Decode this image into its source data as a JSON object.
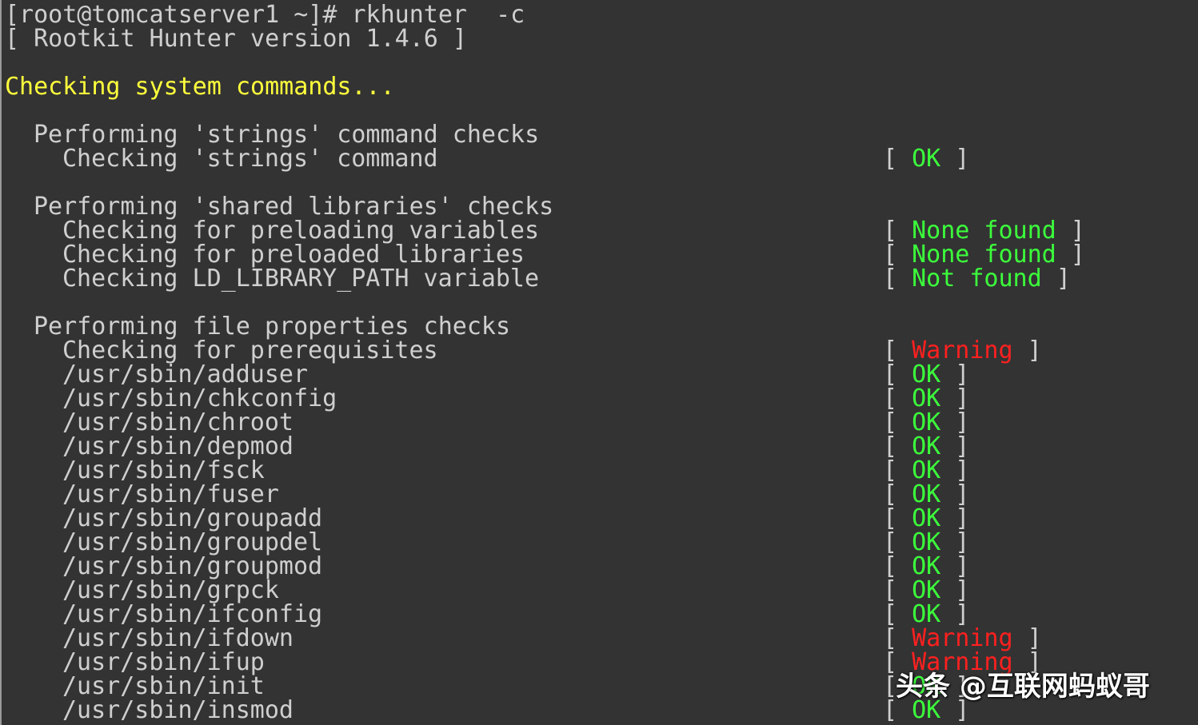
{
  "terminal": {
    "prompt": "[root@tomcatserver1 ~]# rkhunter  -c",
    "version_line": "[ Rootkit Hunter version 1.4.6 ]",
    "section_header": "Checking system commands...",
    "groups": [
      {
        "title": "Performing 'strings' command checks",
        "checks": [
          {
            "label": "Checking 'strings' command",
            "status": "OK",
            "status_color": "#3cff3c"
          }
        ]
      },
      {
        "title": "Performing 'shared libraries' checks",
        "checks": [
          {
            "label": "Checking for preloading variables",
            "status": "None found",
            "status_color": "#3cff3c"
          },
          {
            "label": "Checking for preloaded libraries",
            "status": "None found",
            "status_color": "#3cff3c"
          },
          {
            "label": "Checking LD_LIBRARY_PATH variable",
            "status": "Not found",
            "status_color": "#3cff3c"
          }
        ]
      },
      {
        "title": "Performing file properties checks",
        "checks": [
          {
            "label": "Checking for prerequisites",
            "status": "Warning",
            "status_color": "#ff2020"
          },
          {
            "label": "/usr/sbin/adduser",
            "status": "OK",
            "status_color": "#3cff3c"
          },
          {
            "label": "/usr/sbin/chkconfig",
            "status": "OK",
            "status_color": "#3cff3c"
          },
          {
            "label": "/usr/sbin/chroot",
            "status": "OK",
            "status_color": "#3cff3c"
          },
          {
            "label": "/usr/sbin/depmod",
            "status": "OK",
            "status_color": "#3cff3c"
          },
          {
            "label": "/usr/sbin/fsck",
            "status": "OK",
            "status_color": "#3cff3c"
          },
          {
            "label": "/usr/sbin/fuser",
            "status": "OK",
            "status_color": "#3cff3c"
          },
          {
            "label": "/usr/sbin/groupadd",
            "status": "OK",
            "status_color": "#3cff3c"
          },
          {
            "label": "/usr/sbin/groupdel",
            "status": "OK",
            "status_color": "#3cff3c"
          },
          {
            "label": "/usr/sbin/groupmod",
            "status": "OK",
            "status_color": "#3cff3c"
          },
          {
            "label": "/usr/sbin/grpck",
            "status": "OK",
            "status_color": "#3cff3c"
          },
          {
            "label": "/usr/sbin/ifconfig",
            "status": "OK",
            "status_color": "#3cff3c"
          },
          {
            "label": "/usr/sbin/ifdown",
            "status": "Warning",
            "status_color": "#ff2020"
          },
          {
            "label": "/usr/sbin/ifup",
            "status": "Warning",
            "status_color": "#ff2020"
          },
          {
            "label": "/usr/sbin/init",
            "status": "OK",
            "status_color": "#3cff3c"
          },
          {
            "label": "/usr/sbin/insmod",
            "status": "OK",
            "status_color": "#3cff3c"
          }
        ]
      }
    ]
  },
  "watermark": {
    "text": "头条 @互联网蚂蚁哥"
  },
  "colors": {
    "background": "#333333",
    "text": "#cfcfcf",
    "header": "#ffff3c",
    "ok": "#3cff3c",
    "warning": "#ff2020"
  }
}
